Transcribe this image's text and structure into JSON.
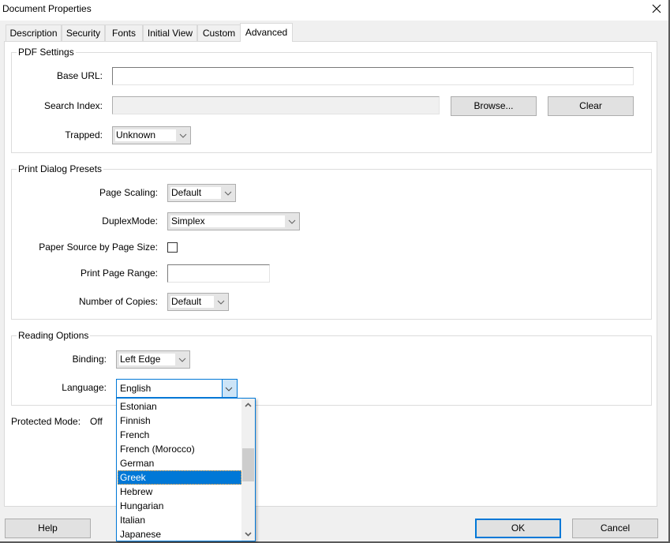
{
  "window": {
    "title": "Document Properties",
    "close_icon": "close-icon"
  },
  "tabs": [
    {
      "label": "Description",
      "active": false
    },
    {
      "label": "Security",
      "active": false
    },
    {
      "label": "Fonts",
      "active": false
    },
    {
      "label": "Initial View",
      "active": false
    },
    {
      "label": "Custom",
      "active": false
    },
    {
      "label": "Advanced",
      "active": true
    }
  ],
  "pdf_settings": {
    "title": "PDF Settings",
    "base_url_label": "Base URL:",
    "base_url_value": "",
    "search_index_label": "Search Index:",
    "search_index_value": "",
    "browse_label": "Browse...",
    "clear_label": "Clear",
    "trapped_label": "Trapped:",
    "trapped_value": "Unknown"
  },
  "print_presets": {
    "title": "Print Dialog Presets",
    "page_scaling_label": "Page Scaling:",
    "page_scaling_value": "Default",
    "duplex_label": "DuplexMode:",
    "duplex_value": "Simplex",
    "paper_source_label": "Paper Source by Page Size:",
    "paper_source_checked": false,
    "page_range_label": "Print Page Range:",
    "page_range_value": "",
    "copies_label": "Number of Copies:",
    "copies_value": "Default"
  },
  "reading_options": {
    "title": "Reading Options",
    "binding_label": "Binding:",
    "binding_value": "Left Edge",
    "language_label": "Language:",
    "language_value": "English",
    "language_options_visible": [
      "Estonian",
      "Finnish",
      "French",
      "French (Morocco)",
      "German",
      "Greek",
      "Hebrew",
      "Hungarian",
      "Italian",
      "Japanese"
    ],
    "language_highlighted": "Greek"
  },
  "protected_mode": {
    "label": "Protected Mode:",
    "value": "Off"
  },
  "buttons": {
    "help": "Help",
    "ok": "OK",
    "cancel": "Cancel"
  },
  "colors": {
    "accent": "#0078d7",
    "dialog_bg": "#f0f0f0",
    "button_bg": "#e1e1e1"
  }
}
